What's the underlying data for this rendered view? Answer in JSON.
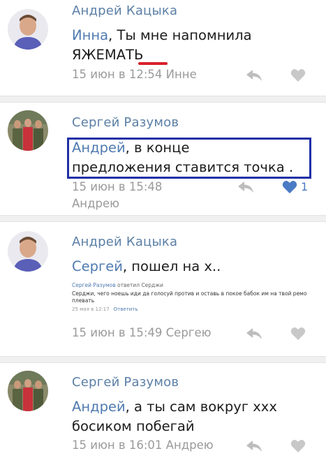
{
  "comments": [
    {
      "author": "Андрей Кацыка",
      "mention": "Инна",
      "text_line1": ", Ты мне напомнила",
      "text_line2": "ЯЖЕМАТЬ",
      "meta": "15 июн в 12:54 Инне",
      "avatar": "person-photo"
    },
    {
      "author": "Сергей Разумов",
      "mention": "Андрей",
      "text_line1": ", в конце",
      "text_line2": "предложения ставится точка .",
      "meta": "15 июн в 15:48",
      "meta_line2": "Андрею",
      "likes": "1",
      "avatar": "group-photo"
    },
    {
      "author": "Андрей Кацыка",
      "mention": "Сергей",
      "text_line1": ", пошел на х..",
      "nested": {
        "name": "Сергей Разумов",
        "action": "ответил Серджи",
        "body": "Серджи, чего ноешь иди да голосуй против и оставь в покое бабок им на твой ремо плевать",
        "date": "25 мая в 12:17",
        "reply": "Ответить"
      },
      "meta": "15 июн в 15:49 Сергею",
      "avatar": "person-photo"
    },
    {
      "author": "Сергей Разумов",
      "mention": "Андрей",
      "text_line1": ", а ты сам вокруг ххх",
      "text_line2": "босиком побегай",
      "meta": "15 июн в 16:01 Андрею",
      "avatar": "group-photo"
    }
  ],
  "colors": {
    "author": "#5b7fa6",
    "mention": "#4f7ab0",
    "meta": "#9a9a9a",
    "liked_heart": "#4b7bc4",
    "highlight_box": "#1f2fa6",
    "underline": "#d8202a"
  },
  "icons": {
    "reply": "reply-arrow-icon",
    "like": "heart-icon"
  }
}
